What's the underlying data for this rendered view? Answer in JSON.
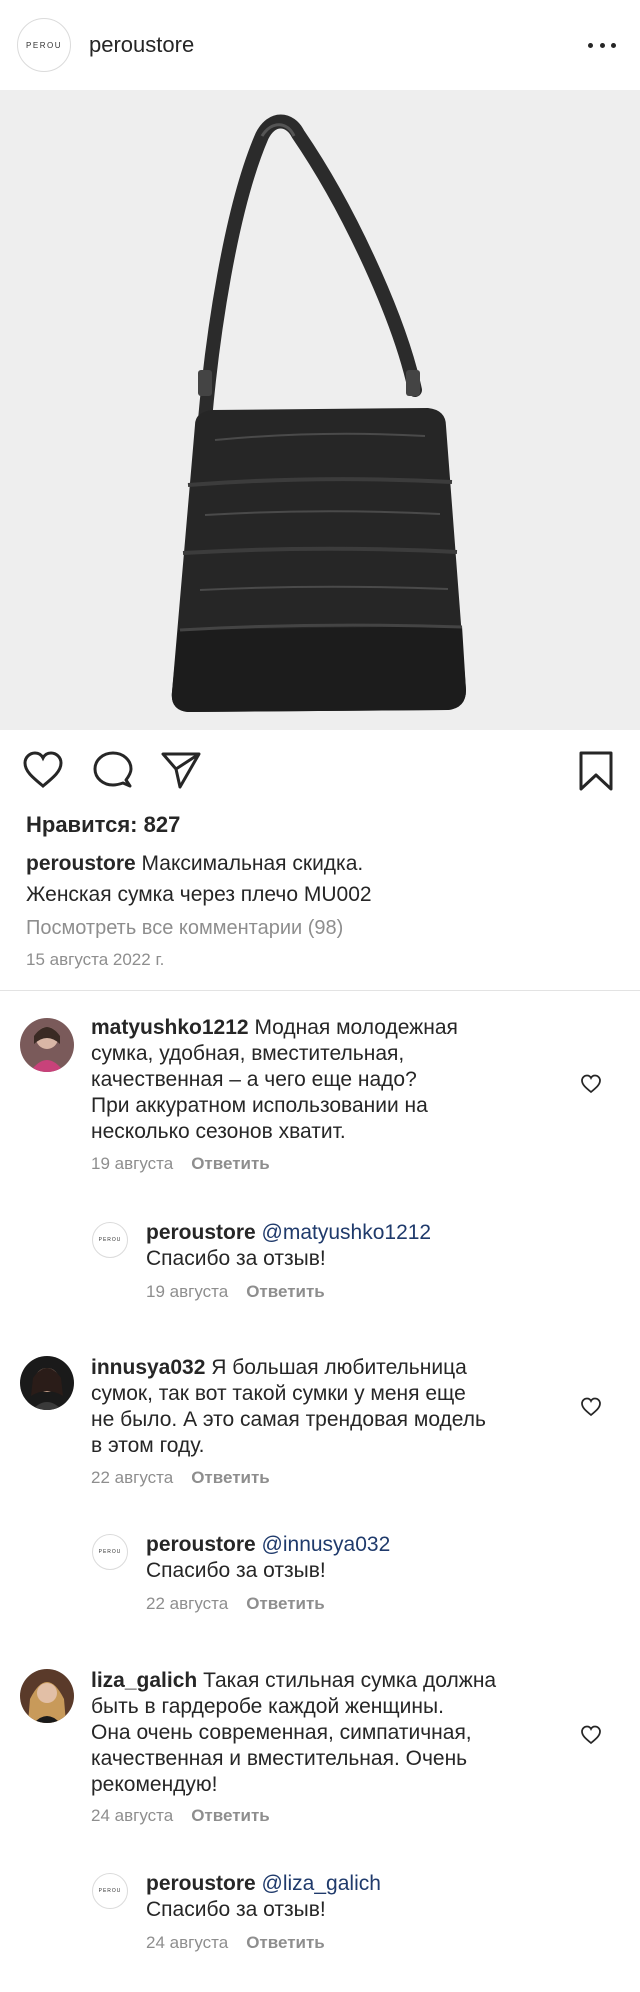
{
  "header": {
    "logo_text": "PEROU",
    "username": "peroustore",
    "more_icon": "more-horizontal-icon"
  },
  "post": {
    "image_description": "black quilted shoulder bag",
    "likes": "Нравится: 827",
    "caption_username": "peroustore",
    "caption_line1": "Максимальная скидка.",
    "caption_line2": "Женская сумка через плечо MU002",
    "view_comments": "Посмотреть все комментарии (98)",
    "date": "15 августа 2022 г."
  },
  "actions": {
    "like_icon": "heart-icon",
    "comment_icon": "comment-icon",
    "share_icon": "send-icon",
    "save_icon": "bookmark-icon"
  },
  "comments": [
    {
      "username": "matyushko1212",
      "lines": [
        "Модная молодежная",
        "сумка, удобная, вместительная,",
        "качественная – а чего еще надо?",
        "При аккуратном использовании на",
        "несколько сезонов хватит."
      ],
      "date": "19 августа",
      "reply": "Ответить"
    },
    {
      "username": "peroustore",
      "mention": "@matyushko1212",
      "line2": "Спасибо за отзыв!",
      "date": "19 августа",
      "reply": "Ответить"
    },
    {
      "username": "innusya032",
      "lines": [
        "Я большая любительница",
        "сумок, так вот такой сумки у меня еще",
        "не было. А это самая трендовая модель",
        "в этом году."
      ],
      "date": "22 августа",
      "reply": "Ответить"
    },
    {
      "username": "peroustore",
      "mention": "@innusya032",
      "line2": "Спасибо за отзыв!",
      "date": "22 августа",
      "reply": "Ответить"
    },
    {
      "username": "liza_galich",
      "lines": [
        "Такая стильная сумка должна",
        "быть в гардеробе каждой женщины.",
        "Она очень современная, симпатичная,",
        "качественная и вместительная. Очень",
        "рекомендую!"
      ],
      "date": "24 августа",
      "reply": "Ответить"
    },
    {
      "username": "peroustore",
      "mention": "@liza_galich",
      "line2": "Спасибо за отзыв!",
      "date": "24 августа",
      "reply": "Ответить"
    }
  ]
}
